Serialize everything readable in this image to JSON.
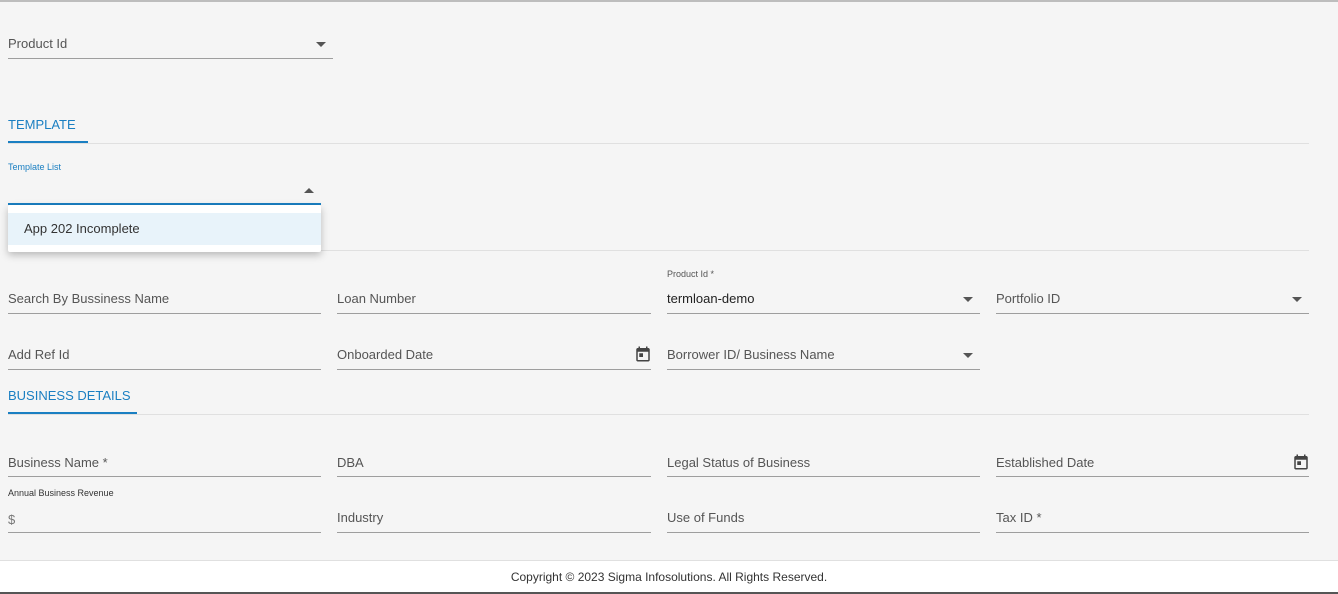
{
  "top": {
    "product_id_label": "Product Id"
  },
  "template": {
    "section_title": "TEMPLATE",
    "list_label": "Template List",
    "options": [
      "App 202 Incomplete"
    ]
  },
  "search": {
    "business_name_label": "Search By Bussiness Name",
    "loan_number_label": "Loan Number",
    "product_id_label": "Product Id *",
    "product_id_value": "termloan-demo",
    "portfolio_label": "Portfolio ID",
    "add_ref_label": "Add Ref Id",
    "onboarded_label": "Onboarded Date",
    "borrower_label": "Borrower ID/ Business Name"
  },
  "business": {
    "section_title": "BUSINESS DETAILS",
    "name_label": "Business Name *",
    "dba_label": "DBA",
    "legal_status_label": "Legal Status of Business",
    "established_label": "Established Date",
    "revenue_label": "Annual Business Revenue",
    "revenue_prefix": "$",
    "industry_label": "Industry",
    "use_of_funds_label": "Use of Funds",
    "tax_id_label": "Tax ID *"
  },
  "footer": {
    "copyright": "Copyright © 2023 Sigma Infosolutions. All Rights Reserved."
  },
  "icons": {
    "dropdown": "chevron-down-icon",
    "dropdown_open": "chevron-up-icon",
    "date": "calendar-icon"
  },
  "colors": {
    "accent": "#1a7fc2",
    "background": "#f5f5f5",
    "option_highlight": "#e8f3fa"
  }
}
